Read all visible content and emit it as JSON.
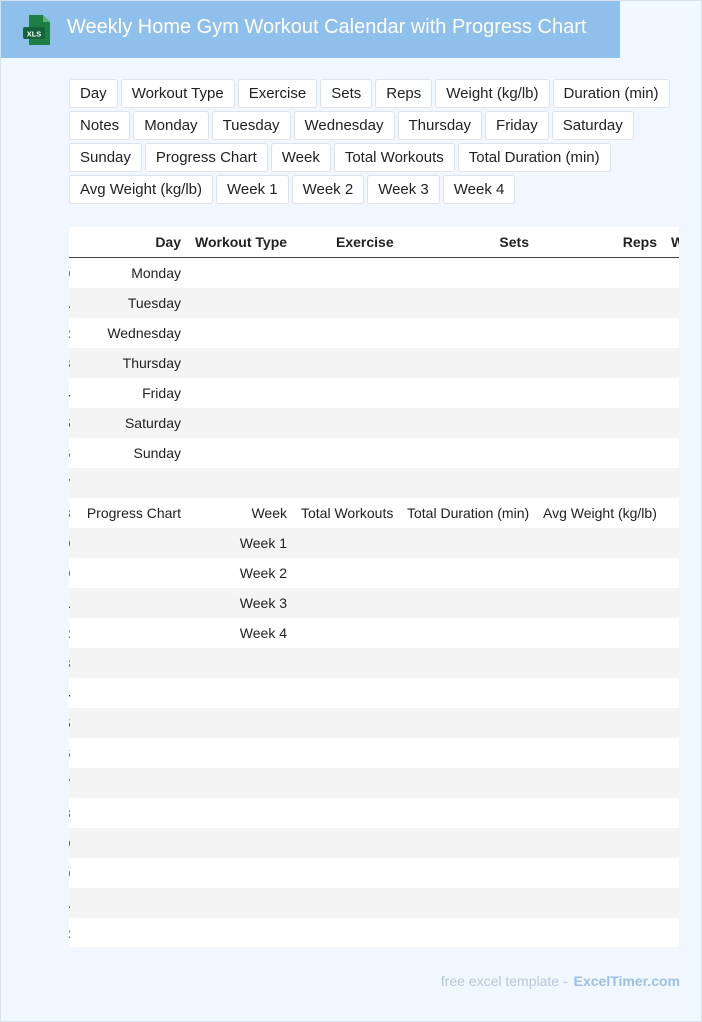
{
  "header": {
    "title": "Weekly Home Gym Workout Calendar with Progress Chart",
    "icon_label": "XLS",
    "icon_color": "#1e7e45"
  },
  "chips": [
    "Day",
    "Workout Type",
    "Exercise",
    "Sets",
    "Reps",
    "Weight (kg/lb)",
    "Duration (min)",
    "Notes",
    "Monday",
    "Tuesday",
    "Wednesday",
    "Thursday",
    "Friday",
    "Saturday",
    "Sunday",
    "Progress Chart",
    "Week",
    "Total Workouts",
    "Total Duration (min)",
    "Avg Weight (kg/lb)",
    "Week 1",
    "Week 2",
    "Week 3",
    "Week 4"
  ],
  "sheet": {
    "headers": [
      "Day",
      "Workout Type",
      "Exercise",
      "Sets",
      "Reps",
      "W"
    ],
    "rows": [
      {
        "num": "0",
        "a": "Monday",
        "b": "",
        "c": "",
        "d": "",
        "e": ""
      },
      {
        "num": "1",
        "a": "Tuesday",
        "b": "",
        "c": "",
        "d": "",
        "e": ""
      },
      {
        "num": "2",
        "a": "Wednesday",
        "b": "",
        "c": "",
        "d": "",
        "e": ""
      },
      {
        "num": "3",
        "a": "Thursday",
        "b": "",
        "c": "",
        "d": "",
        "e": ""
      },
      {
        "num": "4",
        "a": "Friday",
        "b": "",
        "c": "",
        "d": "",
        "e": ""
      },
      {
        "num": "5",
        "a": "Saturday",
        "b": "",
        "c": "",
        "d": "",
        "e": ""
      },
      {
        "num": "6",
        "a": "Sunday",
        "b": "",
        "c": "",
        "d": "",
        "e": ""
      },
      {
        "num": "7",
        "a": "",
        "b": "",
        "c": "",
        "d": "",
        "e": ""
      },
      {
        "num": "8",
        "a": "Progress Chart",
        "b": "Week",
        "c": "Total Workouts",
        "d": "Total Duration (min)",
        "e": "Avg Weight (kg/lb)"
      },
      {
        "num": "9",
        "a": "",
        "b": "Week 1",
        "c": "",
        "d": "",
        "e": ""
      },
      {
        "num": "0",
        "a": "",
        "b": "Week 2",
        "c": "",
        "d": "",
        "e": ""
      },
      {
        "num": "1",
        "a": "",
        "b": "Week 3",
        "c": "",
        "d": "",
        "e": ""
      },
      {
        "num": "2",
        "a": "",
        "b": "Week 4",
        "c": "",
        "d": "",
        "e": ""
      },
      {
        "num": "3",
        "a": "",
        "b": "",
        "c": "",
        "d": "",
        "e": ""
      },
      {
        "num": "4",
        "a": "",
        "b": "",
        "c": "",
        "d": "",
        "e": ""
      },
      {
        "num": "5",
        "a": "",
        "b": "",
        "c": "",
        "d": "",
        "e": ""
      },
      {
        "num": "6",
        "a": "",
        "b": "",
        "c": "",
        "d": "",
        "e": ""
      },
      {
        "num": "7",
        "a": "",
        "b": "",
        "c": "",
        "d": "",
        "e": ""
      },
      {
        "num": "8",
        "a": "",
        "b": "",
        "c": "",
        "d": "",
        "e": ""
      },
      {
        "num": "9",
        "a": "",
        "b": "",
        "c": "",
        "d": "",
        "e": ""
      },
      {
        "num": "0",
        "a": "",
        "b": "",
        "c": "",
        "d": "",
        "e": ""
      },
      {
        "num": "1",
        "a": "",
        "b": "",
        "c": "",
        "d": "",
        "e": ""
      },
      {
        "num": "2",
        "a": "",
        "b": "",
        "c": "",
        "d": "",
        "e": ""
      }
    ]
  },
  "footer": {
    "prefix": "free excel template -",
    "brand": "ExcelTimer.com"
  }
}
